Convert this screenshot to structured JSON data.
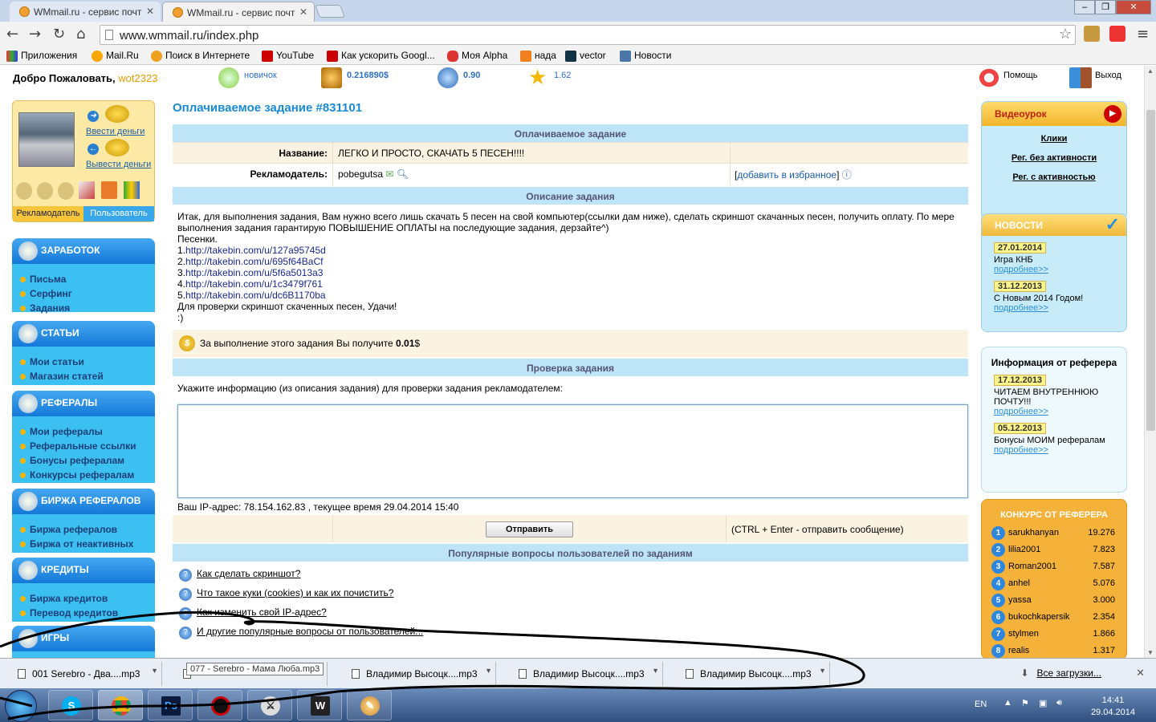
{
  "browser": {
    "tabs": [
      {
        "title": "WMmail.ru - сервис почт"
      },
      {
        "title": "WMmail.ru - сервис почт"
      }
    ],
    "url": "www.wmmail.ru/index.php",
    "bookmarks": [
      "Приложения",
      "Mail.Ru",
      "Поиск в Интернете",
      "YouTube",
      "Как ускорить Googl...",
      "Моя Alpha",
      "нада",
      "vector",
      "Новости"
    ]
  },
  "top": {
    "welcome": "Добро Пожаловать,",
    "username": "wot2323",
    "level": "новичок",
    "balance": "0.216890$",
    "credits": "0.90",
    "rating": "1.62",
    "help": "Помощь",
    "logout": "Выход"
  },
  "userbox": {
    "deposit": "Ввести деньги",
    "withdraw": "Вывести деньги",
    "tab_advertiser": "Рекламодатель",
    "tab_user": "Пользователь"
  },
  "menu": [
    {
      "head": "ЗАРАБОТОК",
      "items": [
        "Письма",
        "Серфинг",
        "Задания"
      ]
    },
    {
      "head": "СТАТЬИ",
      "items": [
        "Мои статьи",
        "Магазин статей"
      ]
    },
    {
      "head": "РЕФЕРАЛЫ",
      "items": [
        "Мои рефералы",
        "Реферальные ссылки",
        "Бонусы рефералам",
        "Конкурсы рефералам"
      ]
    },
    {
      "head": "БИРЖА РЕФЕРАЛОВ",
      "items": [
        "Биржа рефералов",
        "Биржа от неактивных"
      ]
    },
    {
      "head": "КРЕДИТЫ",
      "items": [
        "Биржа кредитов",
        "Перевод кредитов"
      ]
    },
    {
      "head": "ИГРЫ",
      "items": []
    }
  ],
  "task": {
    "title": "Оплачиваемое задание #831101",
    "section_main": "Оплачиваемое задание",
    "name_label": "Название:",
    "name_value": "ЛЕГКО И ПРОСТО, СКАЧАТЬ 5 ПЕСЕН!!!!",
    "advertiser_label": "Рекламодатель:",
    "advertiser_value": "pobegutsa",
    "add_favorite": "добавить в избранное",
    "section_desc": "Описание задания",
    "desc_intro": "Итак, для выполнения задания, Вам нужно всего лишь скачать 5 песен на свой компьютер(ссылки дам ниже), сделать скриншот скачанных песен, получить оплату. По мере выполнения задания гарантирую ПОВЫШЕНИЕ ОПЛАТЫ на последующие задания, дерзайте^)",
    "desc_songs": "Песенки.",
    "links": [
      "http://takebin.com/u/127a95745d",
      "http://takebin.com/u/695f64BaCf",
      "http://takebin.com/u/5f6a5013a3",
      "http://takebin.com/u/1c3479f761",
      "http://takebin.com/u/dc6B1170ba"
    ],
    "desc_outro": "Для проверки скриншот скаченных песен, Удачи!",
    "desc_smile": ":)",
    "pay_text": "За выполнение этого задания Вы получите",
    "pay_amount": "0.01",
    "pay_currency": "$",
    "section_check": "Проверка задания",
    "check_prompt": "Укажите информацию (из описания задания) для проверки задания рекламодателем:",
    "ip_line": "Ваш IP-адрес: 78.154.162.83 , текущее время 29.04.2014 15:40",
    "send": "Отправить",
    "send_hint": "(CTRL + Enter - отправить сообщение)",
    "section_faq": "Популярные вопросы пользователей по заданиям",
    "faq": [
      "Как сделать скриншот?",
      "Что такое куки (cookies) и как их почистить?",
      "Как изменить свой IP-адрес?",
      "И другие популярные вопросы от пользователей..."
    ]
  },
  "right": {
    "video_head": "Видеоурок",
    "video_links": [
      "Клики",
      "Рег. без активности",
      "Рег. с активностью"
    ],
    "news_head": "НОВОСТИ",
    "news": [
      {
        "date": "27.01.2014",
        "text": "Игра КНБ",
        "more": "подробнее>>"
      },
      {
        "date": "31.12.2013",
        "text": "С Новым 2014 Годом!",
        "more": "подробнее>>"
      }
    ],
    "ref_head": "Информация от реферера",
    "ref_news": [
      {
        "date": "17.12.2013",
        "text": "ЧИТАЕМ ВНУТРЕННЮЮ ПОЧТУ!!!",
        "more": "подробнее>>"
      },
      {
        "date": "05.12.2013",
        "text": "Бонусы МОИМ рефералам",
        "more": "подробнее>>"
      }
    ],
    "contest_head": "КОНКУРС ОТ РЕФЕРЕРА",
    "contest": [
      {
        "n": "1",
        "name": "sarukhanyan",
        "score": "19.276"
      },
      {
        "n": "2",
        "name": "lilia2001",
        "score": "7.823"
      },
      {
        "n": "3",
        "name": "Roman2001",
        "score": "7.587"
      },
      {
        "n": "4",
        "name": "anhel",
        "score": "5.076"
      },
      {
        "n": "5",
        "name": "yassa",
        "score": "3.000"
      },
      {
        "n": "6",
        "name": "bukochkapersik",
        "score": "2.354"
      },
      {
        "n": "7",
        "name": "stylmen",
        "score": "1.866"
      },
      {
        "n": "8",
        "name": "realis",
        "score": "1.317"
      }
    ]
  },
  "downloads": {
    "items": [
      "001 Serebro - Два....mp3",
      "",
      "Владимир Высоцк....mp3",
      "Владимир Высоцк....mp3",
      "Владимир Высоцк....mp3"
    ],
    "tooltip": "077 - Serebro - Мама Люба.mp3",
    "all": "Все загрузки..."
  },
  "taskbar": {
    "lang": "EN",
    "time": "14:41",
    "date": "29.04.2014"
  }
}
